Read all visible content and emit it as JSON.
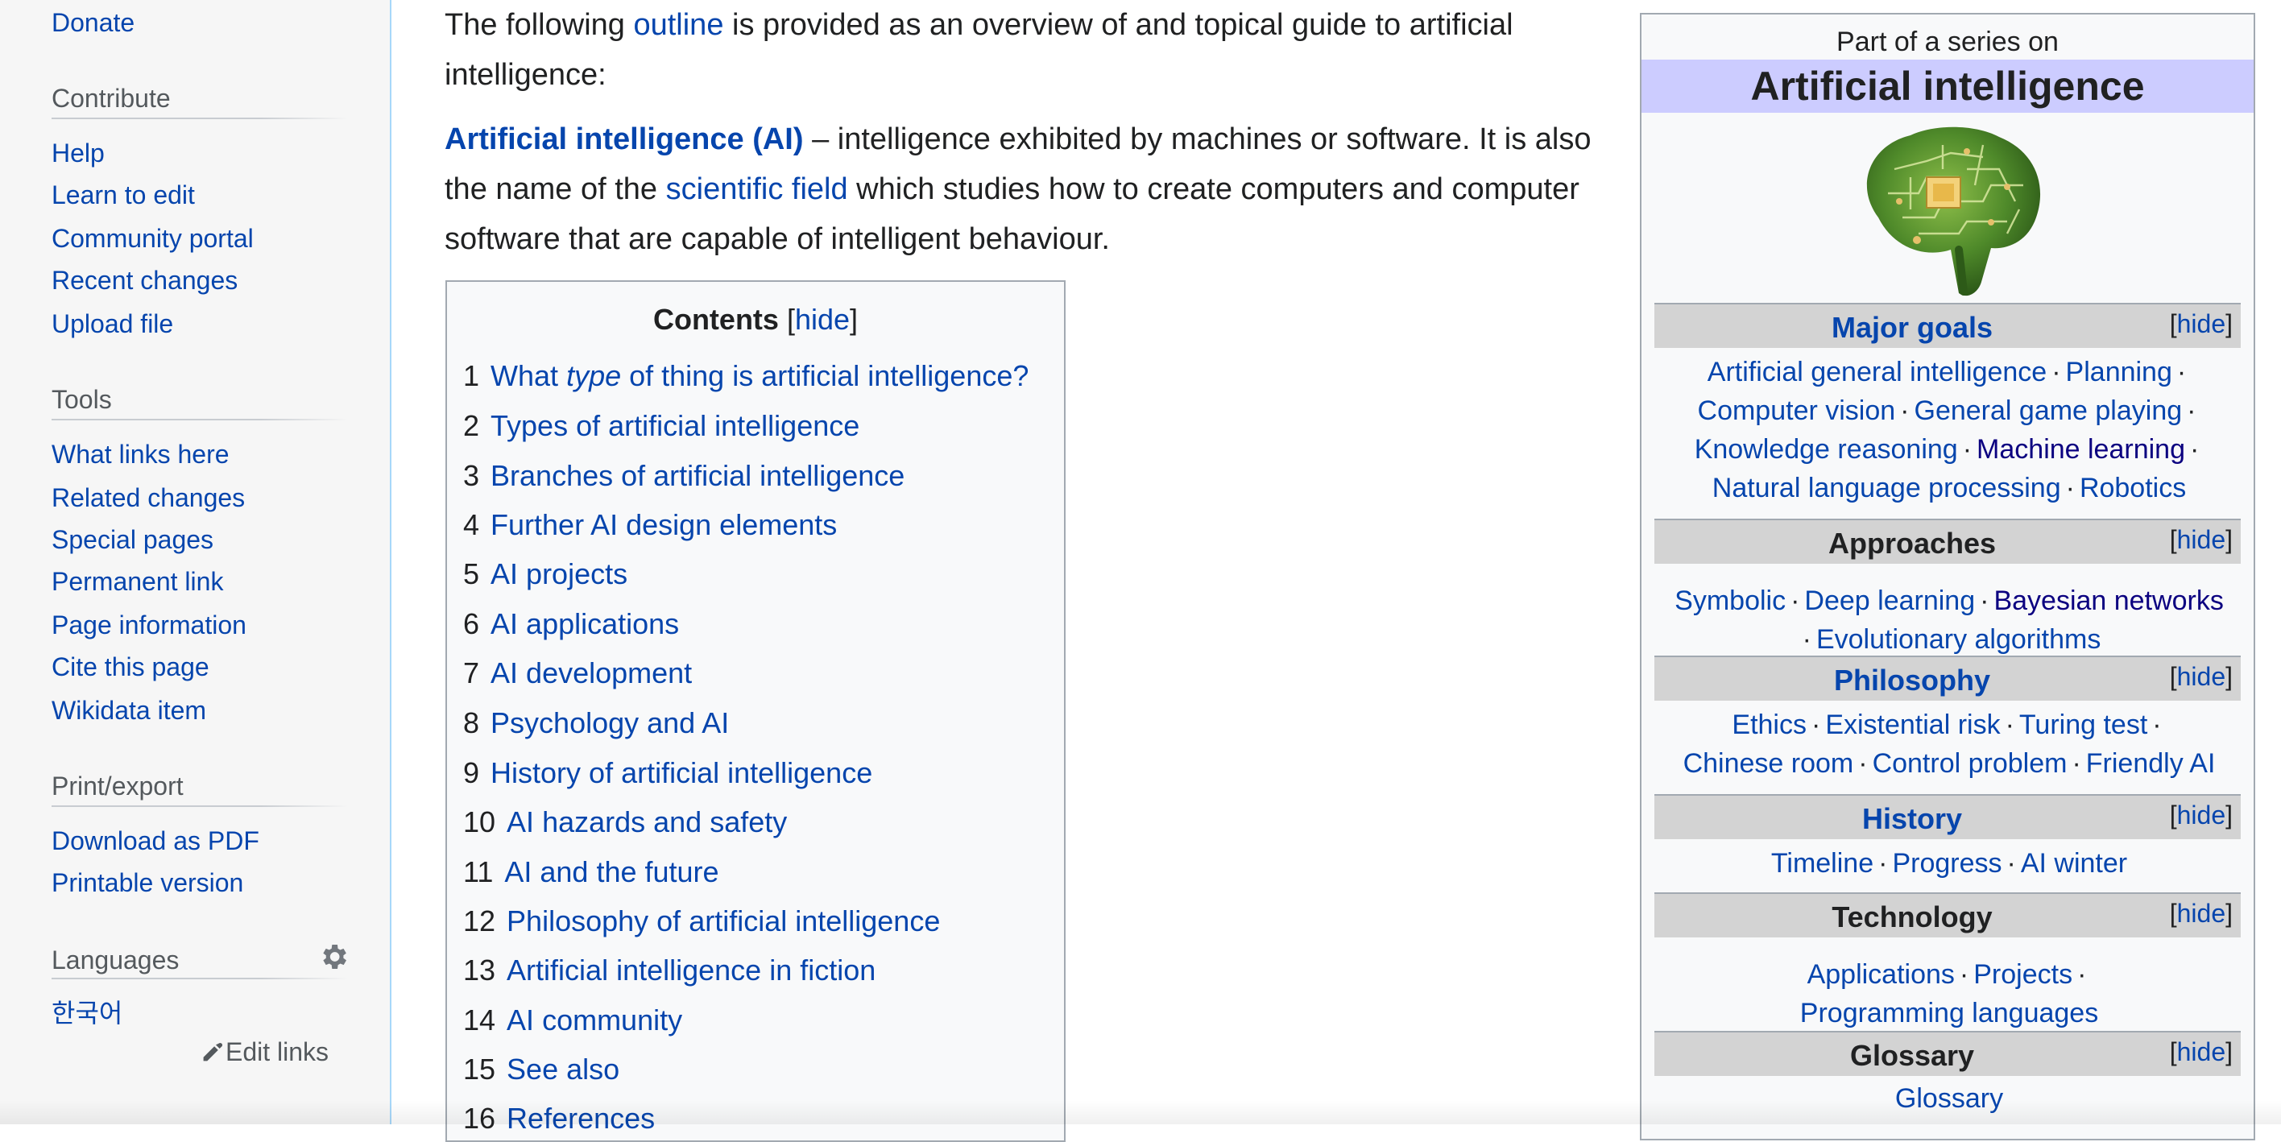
{
  "sidebar": {
    "donate": "Donate",
    "contribute_heading": "Contribute",
    "contribute": [
      "Help",
      "Learn to edit",
      "Community portal",
      "Recent changes",
      "Upload file"
    ],
    "tools_heading": "Tools",
    "tools": [
      "What links here",
      "Related changes",
      "Special pages",
      "Permanent link",
      "Page information",
      "Cite this page",
      "Wikidata item"
    ],
    "print_heading": "Print/export",
    "print": [
      "Download as PDF",
      "Printable version"
    ],
    "languages_heading": "Languages",
    "language_korean": "한국어",
    "edit_links": "Edit links"
  },
  "article": {
    "intro_1": "The following ",
    "intro_link": "outline",
    "intro_2": " is provided as an overview of and topical guide to artificial intelligence:",
    "def_bold": "Artificial intelligence (AI)",
    "def_1": " – intelligence exhibited by machines or software. It is also the name of the ",
    "def_link": "scientific field",
    "def_2": " which studies how to create computers and computer software that are capable of intelligent behaviour."
  },
  "toc": {
    "title": "Contents",
    "hide": "hide",
    "items": [
      {
        "num": "1",
        "pre": "What ",
        "em": "type",
        "post": " of thing is artificial intelligence?"
      },
      {
        "num": "2",
        "text": "Types of artificial intelligence"
      },
      {
        "num": "3",
        "text": "Branches of artificial intelligence"
      },
      {
        "num": "4",
        "text": "Further AI design elements"
      },
      {
        "num": "5",
        "text": "AI projects"
      },
      {
        "num": "6",
        "text": "AI applications"
      },
      {
        "num": "7",
        "text": "AI development"
      },
      {
        "num": "8",
        "text": "Psychology and AI"
      },
      {
        "num": "9",
        "text": "History of artificial intelligence"
      },
      {
        "num": "10",
        "text": "AI hazards and safety"
      },
      {
        "num": "11",
        "text": "AI and the future"
      },
      {
        "num": "12",
        "text": "Philosophy of artificial intelligence"
      },
      {
        "num": "13",
        "text": "Artificial intelligence in fiction"
      },
      {
        "num": "14",
        "text": "AI community"
      },
      {
        "num": "15",
        "text": "See also"
      },
      {
        "num": "16",
        "text": "References"
      }
    ]
  },
  "infobox": {
    "above": "Part of a series on",
    "title": "Artificial intelligence",
    "hide": "hide",
    "major_goals": "Major goals",
    "goals": [
      "Artificial general intelligence",
      "Planning",
      "Computer vision",
      "General game playing",
      "Knowledge reasoning",
      "Machine learning",
      "Natural language processing",
      "Robotics"
    ],
    "approaches": "Approaches",
    "approach_items": [
      "Symbolic",
      "Deep learning",
      "Bayesian networks",
      "Evolutionary algorithms"
    ],
    "philosophy": "Philosophy",
    "philosophy_items": [
      "Ethics",
      "Existential risk",
      "Turing test",
      "Chinese room",
      "Control problem",
      "Friendly AI"
    ],
    "history": "History",
    "history_items": [
      "Timeline",
      "Progress",
      "AI winter"
    ],
    "technology": "Technology",
    "technology_items": [
      "Applications",
      "Projects",
      "Programming languages"
    ],
    "glossary": "Glossary",
    "glossary_items": [
      "Glossary"
    ]
  },
  "colors": {
    "link": "#0645ad",
    "visited": "#0b0080",
    "sidebar_bg": "#f6f6f6",
    "title_bg": "#ccccff",
    "header_bg": "#d3d3d3"
  }
}
